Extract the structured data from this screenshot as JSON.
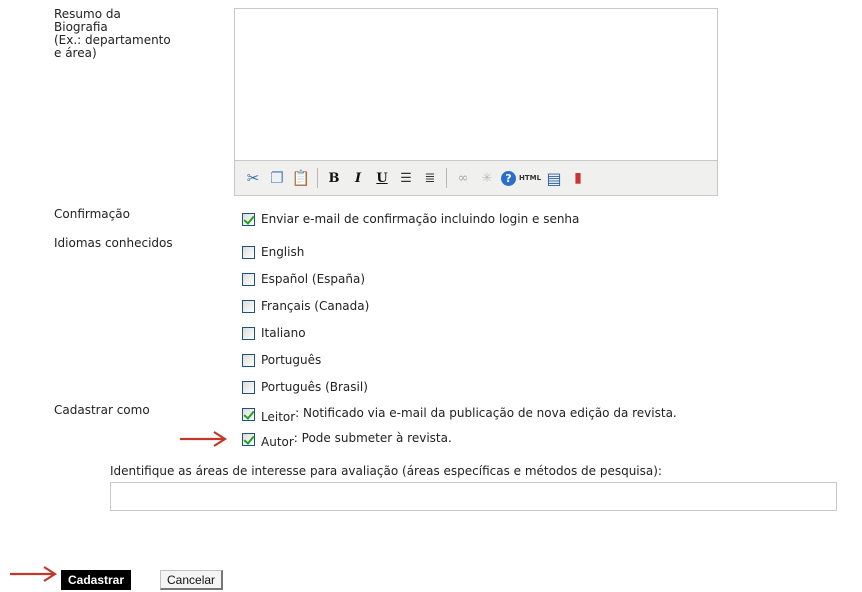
{
  "biography": {
    "label": "Resumo da\nBiografia\n(Ex.: departamento\ne área)",
    "toolbar": [
      {
        "name": "cut-icon",
        "glyph": "✂",
        "color": "#3a6fb0"
      },
      {
        "name": "copy-icon",
        "glyph": "❐",
        "color": "#5a8ac6"
      },
      {
        "name": "paste-icon",
        "glyph": "📋",
        "color": "#c89a3c"
      },
      {
        "sep": true
      },
      {
        "name": "bold-icon",
        "glyph": "B",
        "color": "#111"
      },
      {
        "name": "italic-icon",
        "glyph": "I",
        "color": "#111"
      },
      {
        "name": "underline-icon",
        "glyph": "U",
        "color": "#111"
      },
      {
        "name": "bullet-list-icon",
        "glyph": "☰",
        "color": "#333"
      },
      {
        "name": "numbered-list-icon",
        "glyph": "≣",
        "color": "#333"
      },
      {
        "sep": true
      },
      {
        "name": "link-icon",
        "glyph": "∞",
        "color": "#aaa"
      },
      {
        "name": "unlink-icon",
        "glyph": "✳",
        "color": "#bbb"
      },
      {
        "name": "help-icon",
        "glyph": "?",
        "color": "#fff"
      },
      {
        "name": "html-icon",
        "glyph": "HTML",
        "color": "#333"
      },
      {
        "name": "fullscreen-icon",
        "glyph": "▤",
        "color": "#2b5fa8"
      },
      {
        "name": "document-icon",
        "glyph": "▮",
        "color": "#c33"
      }
    ]
  },
  "confirmation": {
    "label": "Confirmação",
    "text": "Enviar e-mail de confirmação incluindo login e senha",
    "checked": true
  },
  "languages": {
    "label": "Idiomas conhecidos",
    "items": [
      {
        "label": "English",
        "checked": false
      },
      {
        "label": "Español (España)",
        "checked": false
      },
      {
        "label": "Français (Canada)",
        "checked": false
      },
      {
        "label": "Italiano",
        "checked": false
      },
      {
        "label": "Português",
        "checked": false
      },
      {
        "label": "Português (Brasil)",
        "checked": false
      }
    ]
  },
  "register_as": {
    "label": "Cadastrar como",
    "roles": [
      {
        "name": "Leitor",
        "desc": ": Notificado via e-mail da publicação de nova edição da revista.",
        "checked": true
      },
      {
        "name": "Autor",
        "desc": ": Pode submeter à revista.",
        "checked": true
      }
    ]
  },
  "interests": {
    "label": "Identifique as áreas de interesse para avaliação (áreas específicas e métodos de pesquisa):",
    "value": ""
  },
  "actions": {
    "submit_label": "Cadastrar",
    "cancel_label": "Cancelar"
  },
  "colors": {
    "arrow": "#c0392b",
    "check": "#21a121",
    "checkbox_border": "#1c5180"
  }
}
